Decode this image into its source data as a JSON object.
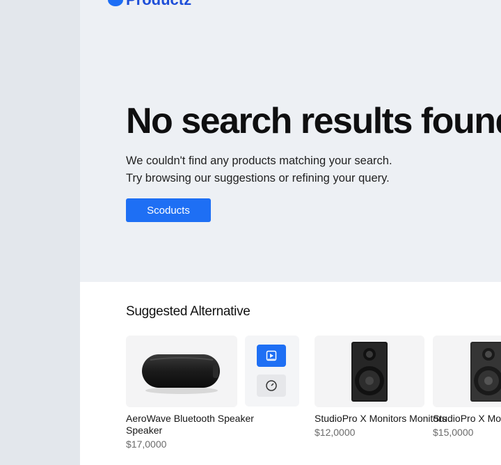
{
  "brand": {
    "name": "Productz"
  },
  "hero": {
    "title": "No search results found",
    "line1": "We couldn't find any products matching your search.",
    "line2": "Try browsing our suggestions or refining your query.",
    "cta_label": "Scoducts"
  },
  "suggestions": {
    "title": "Suggested Alternative",
    "items": [
      {
        "name": "AeroWave Bluetooth Speaker Speaker",
        "price": "$17,0000",
        "image": "bluetooth-speaker"
      },
      {
        "name": "StudioPro X Monitors Monitors",
        "price": "$12,0000",
        "image": "studio-monitor"
      },
      {
        "name": "StudioPro X Monitors Speaker",
        "price": "$15,0000",
        "image": "studio-monitor"
      }
    ],
    "mini_panel_icons": [
      "play-icon",
      "gauge-icon"
    ]
  },
  "colors": {
    "accent": "#1e6ff4",
    "hero_bg": "#edf0f4",
    "rail_bg": "#e3e7ec"
  }
}
